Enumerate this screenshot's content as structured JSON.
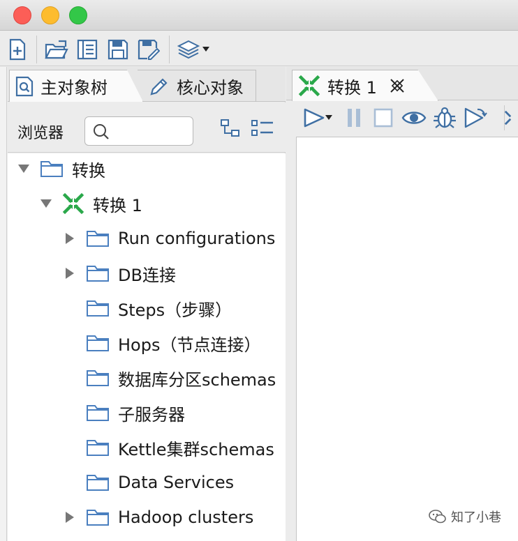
{
  "left_panel": {
    "tabs": [
      {
        "label": "主对象树",
        "icon": "search-document-icon"
      },
      {
        "label": "核心对象",
        "icon": "pencil-icon"
      }
    ],
    "browser_label": "浏览器",
    "search": {
      "value": "",
      "placeholder": ""
    },
    "tree": {
      "root": {
        "label": "转换",
        "expanded": true
      },
      "transformation": {
        "label": "转换 1",
        "icon": "transformation-icon",
        "expanded": true
      },
      "items": [
        {
          "label": "Run configurations",
          "has_children": true
        },
        {
          "label": "DB连接",
          "has_children": true
        },
        {
          "label": "Steps（步骤）",
          "has_children": false
        },
        {
          "label": "Hops（节点连接）",
          "has_children": false
        },
        {
          "label": "数据库分区schemas",
          "has_children": false
        },
        {
          "label": "子服务器",
          "has_children": false
        },
        {
          "label": "Kettle集群schemas",
          "has_children": false
        },
        {
          "label": "Data Services",
          "has_children": false
        },
        {
          "label": "Hadoop clusters",
          "has_children": true
        }
      ]
    }
  },
  "right_panel": {
    "tab": {
      "label": "转换 1",
      "icon": "transformation-icon"
    }
  },
  "watermark": {
    "text": "知了小巷"
  },
  "colors": {
    "accent_green": "#2aa84a",
    "icon_blue": "#3f6fa3",
    "folder_blue": "#4a7fbf"
  }
}
